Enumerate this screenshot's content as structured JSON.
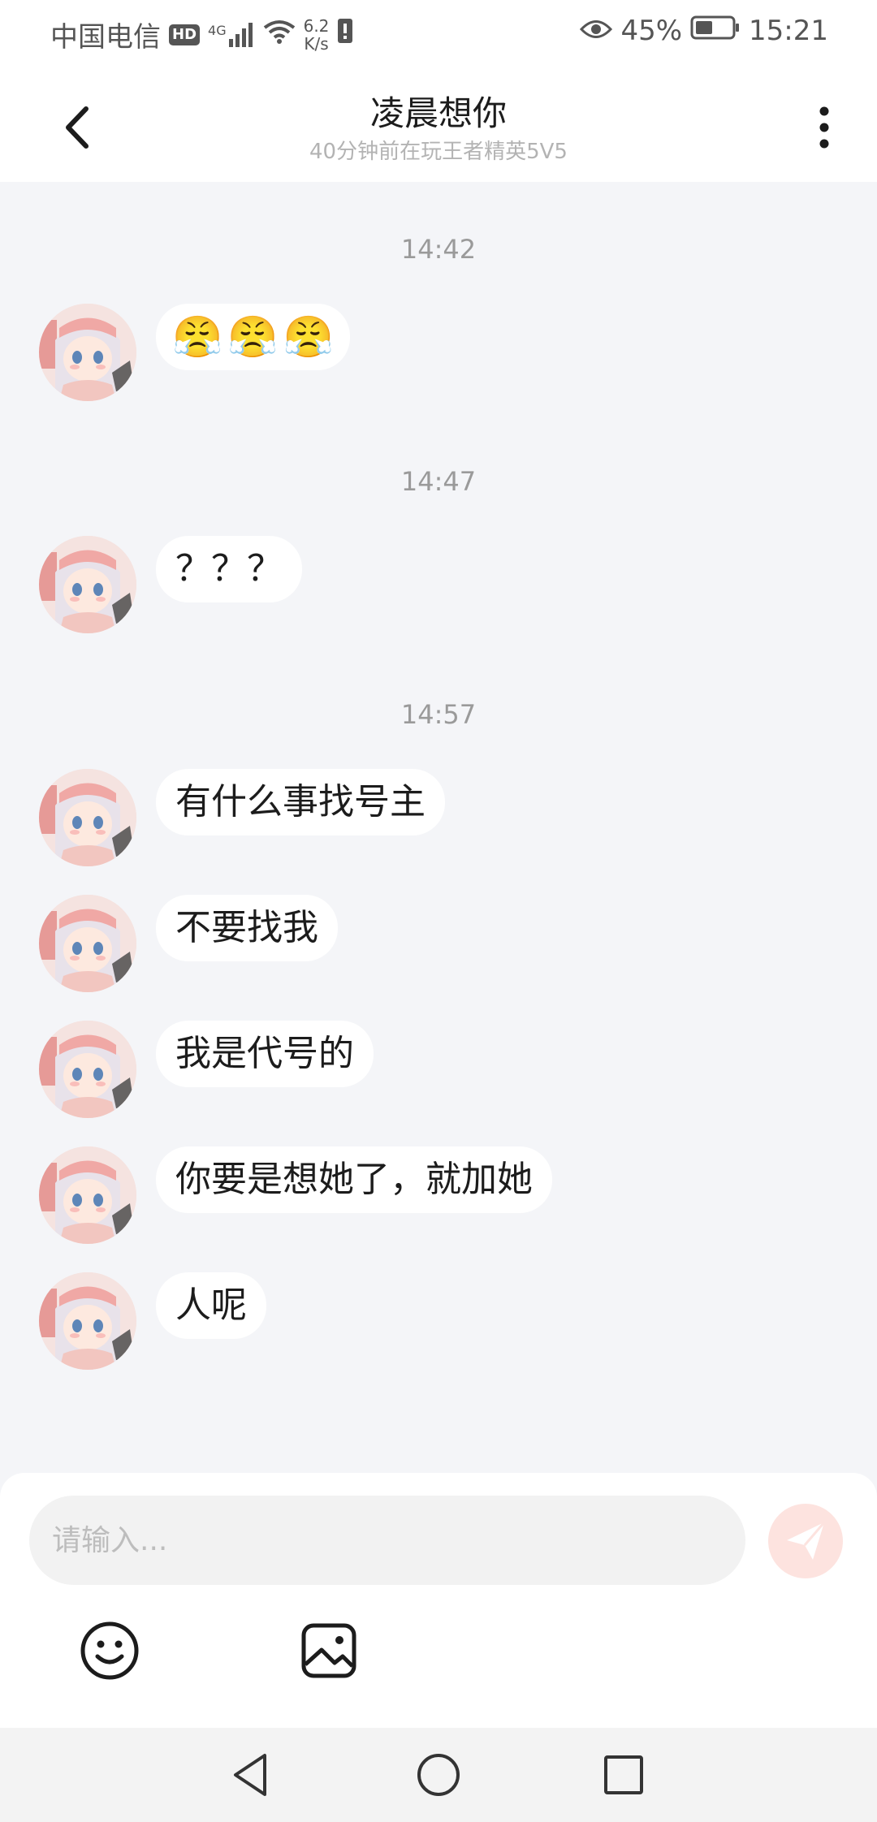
{
  "status_bar": {
    "carrier": "中国电信",
    "hd": "HD",
    "net": "4G",
    "speed_value": "6.2",
    "speed_unit": "K/s",
    "battery_percent": "45%",
    "time": "15:21"
  },
  "header": {
    "title": "凌晨想你",
    "subtitle": "40分钟前在玩王者精英5V5"
  },
  "chat": {
    "timestamps": [
      "14:42",
      "14:47",
      "14:57"
    ],
    "messages": [
      {
        "type": "emoji",
        "emoji": [
          "😤",
          "😤",
          "😤"
        ]
      },
      {
        "type": "text",
        "text": "？？？"
      },
      {
        "type": "text",
        "text": "有什么事找号主"
      },
      {
        "type": "text",
        "text": "不要找我"
      },
      {
        "type": "text",
        "text": "我是代号的"
      },
      {
        "type": "text",
        "text": "你要是想她了，就加她"
      },
      {
        "type": "text",
        "text": "人呢"
      }
    ]
  },
  "composer": {
    "placeholder": "请输入..."
  },
  "icons": {
    "back": "chevron-left-icon",
    "more": "more-vertical-icon",
    "send": "send-icon",
    "emoji": "smiley-icon",
    "image": "image-icon",
    "nav_back": "triangle-back-icon",
    "nav_home": "circle-home-icon",
    "nav_recent": "square-recent-icon"
  },
  "colors": {
    "chat_bg": "#f4f5f8",
    "bubble": "#ffffff",
    "send_button": "#fde3df",
    "timestamp": "#9a9a9a"
  }
}
